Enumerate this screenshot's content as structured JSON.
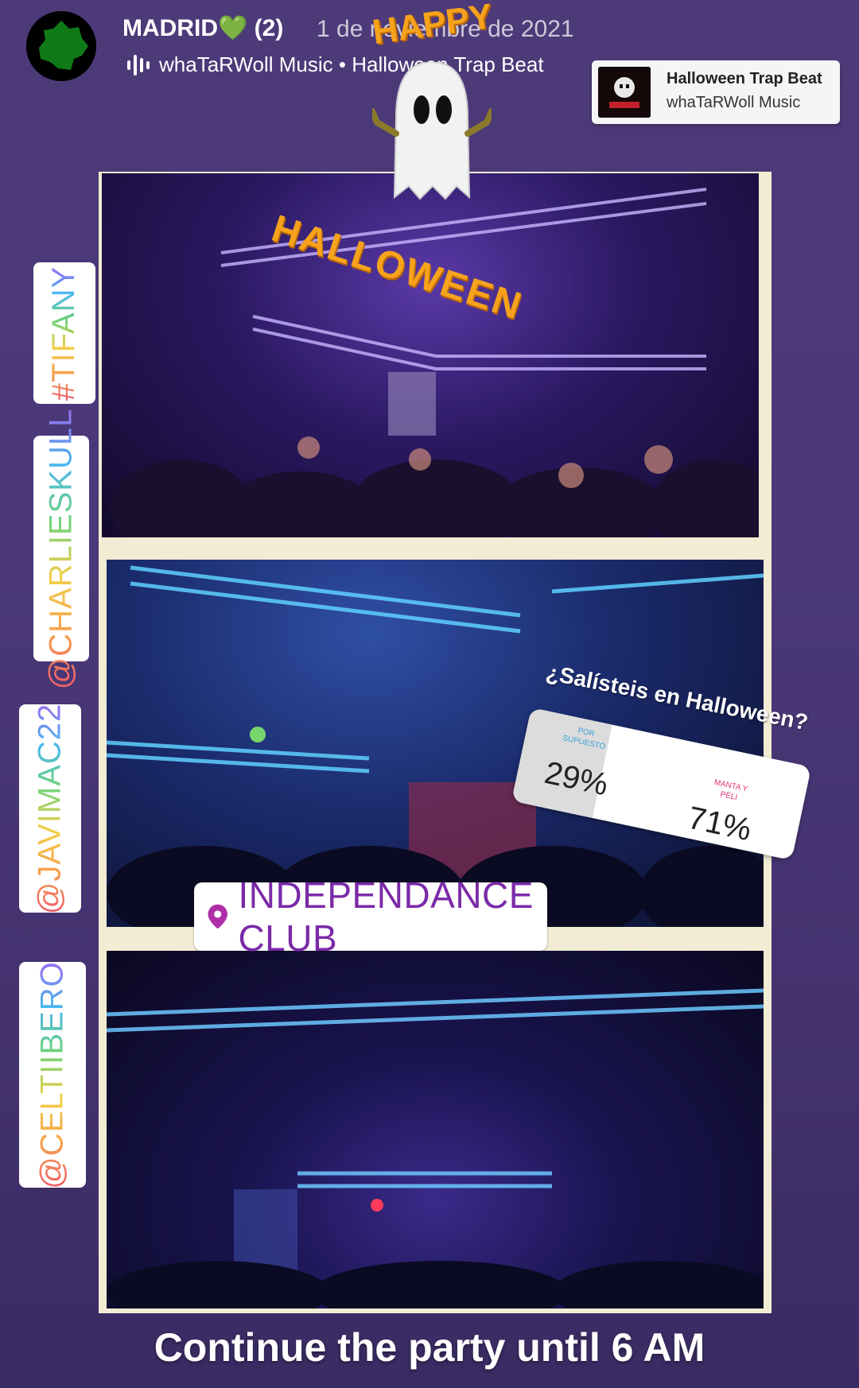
{
  "header": {
    "username": "MADRID💚 (2)",
    "date": "1 de noviembre de 2021",
    "music_line": "whaTaRWoll Music • Halloween Trap Beat"
  },
  "music_card": {
    "track": "Halloween Trap Beat",
    "artist": "whaTaRWoll Music"
  },
  "stickers": {
    "happy": "HAPPY",
    "halloween": "HALLOWEEN",
    "mentions": [
      "#TIFANY",
      "@CHARLIESKULL",
      "@JAVIMAC22",
      "@CELTIIBERO"
    ],
    "location": "INDEPENDANCE CLUB"
  },
  "poll": {
    "question": "¿Salísteis en Halloween?",
    "options": [
      {
        "label": "POR SUPUESTO",
        "percent": "29%",
        "color": "#3a9fd8"
      },
      {
        "label": "MANTA Y PELI",
        "percent": "71%",
        "color": "#e0337a"
      }
    ]
  },
  "caption": "Continue the party until 6 AM",
  "icons": {
    "avatar": "madrid-region-map-icon",
    "music": "audio-bars-icon",
    "location": "location-pin-icon",
    "ghost": "ghost-icon"
  }
}
